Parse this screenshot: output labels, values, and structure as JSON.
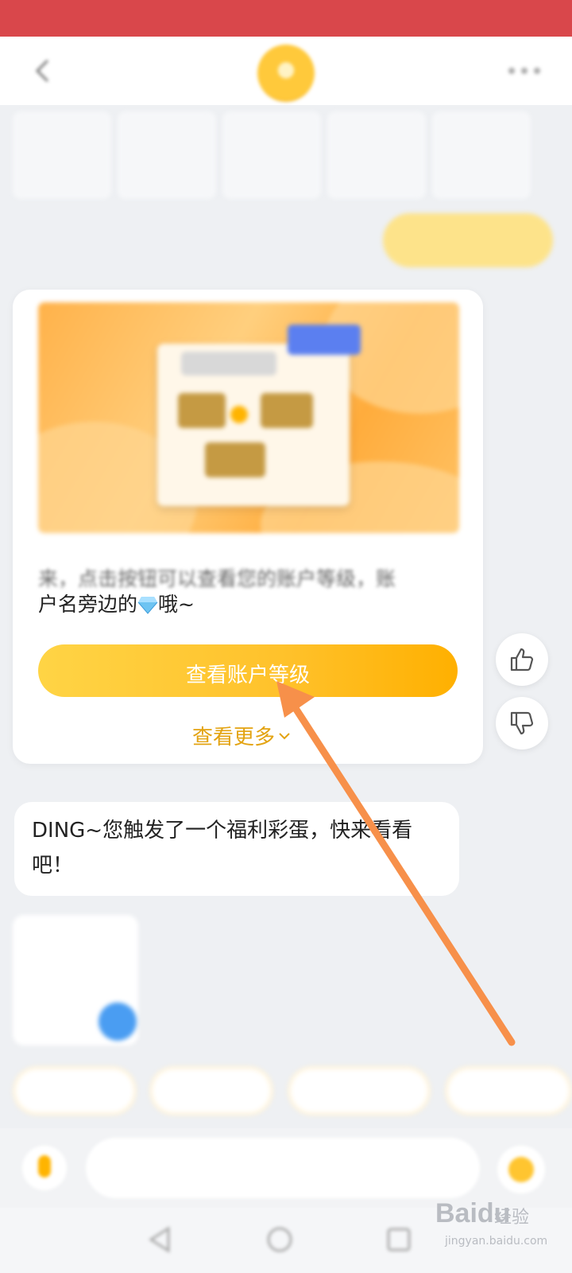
{
  "status_bar": {
    "left_text": "",
    "right_text": ""
  },
  "header": {
    "back_icon": "chevron-left-icon",
    "avatar_icon": "assistant-avatar",
    "more_icon": "ellipsis-icon"
  },
  "quick_tabs": [
    "",
    "",
    "",
    "",
    ""
  ],
  "user_message": "",
  "reply_card": {
    "text_line_1": "来，点击按钮可以查看您的账户等级，账",
    "text_line_2": "户名旁边的",
    "text_line_2_suffix": "哦~",
    "inline_icon": "diamond-icon",
    "primary_button_label": "查看账户等级",
    "truncated_text": "",
    "see_more_label": "查看更多"
  },
  "feedback": {
    "like_icon": "thumbs-up-icon",
    "dislike_icon": "thumbs-down-icon"
  },
  "ding_message": "DING~您触发了一个福利彩蛋，快来看看吧！",
  "gift_card": {
    "title": "",
    "subtitle": ""
  },
  "suggestion_chips": [
    "",
    "",
    "",
    ""
  ],
  "input_bar": {
    "placeholder": ""
  },
  "nav_bar": {
    "icons": [
      "back-icon",
      "home-icon",
      "recent-apps-icon"
    ]
  },
  "watermark": {
    "logo": "Baidu",
    "cn": "经验",
    "url": "jingyan.baidu.com"
  },
  "colors": {
    "status_bar": "#d9474b",
    "accent": "#ffc12a",
    "see_more": "#e3a311",
    "arrow": "#f7904a"
  }
}
